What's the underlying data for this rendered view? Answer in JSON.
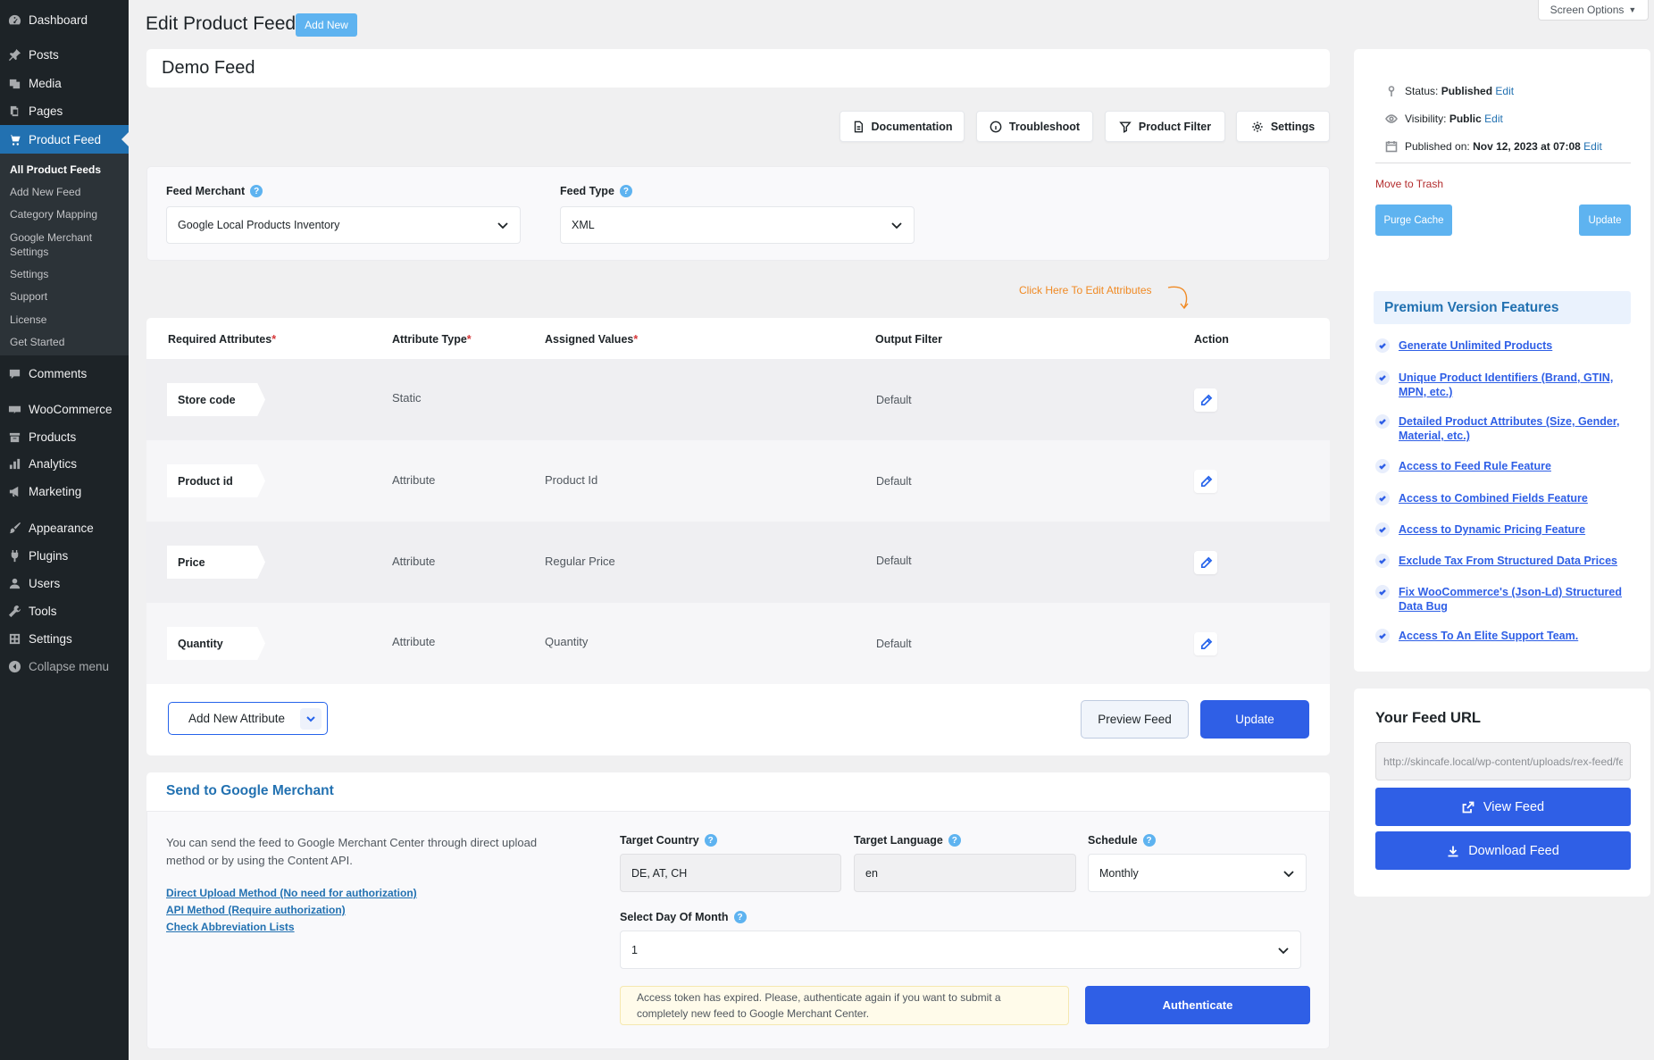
{
  "sidebar": {
    "menu": [
      {
        "label": "Dashboard",
        "icon": "dashboard-icon"
      },
      {
        "label": "Posts",
        "icon": "pin-icon"
      },
      {
        "label": "Media",
        "icon": "media-icon"
      },
      {
        "label": "Pages",
        "icon": "pages-icon"
      },
      {
        "label": "Product Feed",
        "icon": "cart-icon"
      },
      {
        "label": "Comments",
        "icon": "comment-icon"
      },
      {
        "label": "WooCommerce",
        "icon": "woo-icon"
      },
      {
        "label": "Products",
        "icon": "archive-icon"
      },
      {
        "label": "Analytics",
        "icon": "bar-chart-icon"
      },
      {
        "label": "Marketing",
        "icon": "megaphone-icon"
      },
      {
        "label": "Appearance",
        "icon": "brush-icon"
      },
      {
        "label": "Plugins",
        "icon": "plug-icon"
      },
      {
        "label": "Users",
        "icon": "user-icon"
      },
      {
        "label": "Tools",
        "icon": "wrench-icon"
      },
      {
        "label": "Settings",
        "icon": "settings-grid-icon"
      },
      {
        "label": "Collapse menu",
        "icon": "collapse-icon"
      }
    ],
    "submenu": [
      "All Product Feeds",
      "Add New Feed",
      "Category Mapping",
      "Google Merchant Settings",
      "Settings",
      "Support",
      "License",
      "Get Started"
    ]
  },
  "header": {
    "title": "Edit Product Feed",
    "add_new": "Add New",
    "screen_options": "Screen Options",
    "screen_options_arrow": "▼"
  },
  "feed": {
    "name": "Demo Feed"
  },
  "toolbar": {
    "documentation": "Documentation",
    "troubleshoot": "Troubleshoot",
    "product_filter": "Product Filter",
    "settings": "Settings"
  },
  "merchant": {
    "feed_merchant_label": "Feed Merchant",
    "feed_merchant_value": "Google Local Products Inventory",
    "feed_type_label": "Feed Type",
    "feed_type_value": "XML",
    "help_glyph": "?"
  },
  "attributes": {
    "edit_hint": "Click Here To Edit Attributes",
    "headers": {
      "required": "Required Attributes",
      "type": "Attribute Type",
      "values": "Assigned Values",
      "filter": "Output Filter",
      "action": "Action",
      "req_mark": "*"
    },
    "rows": [
      {
        "name": "Store code",
        "type": "Static",
        "value": "",
        "filter": "Default"
      },
      {
        "name": "Product id",
        "type": "Attribute",
        "value": "Product Id",
        "filter": "Default"
      },
      {
        "name": "Price",
        "type": "Attribute",
        "value": "Regular Price",
        "filter": "Default"
      },
      {
        "name": "Quantity",
        "type": "Attribute",
        "value": "Quantity",
        "filter": "Default"
      }
    ],
    "add_new": "Add New Attribute",
    "preview": "Preview Feed",
    "update": "Update"
  },
  "google_merchant": {
    "title": "Send to Google Merchant",
    "description": "You can send the feed to Google Merchant Center through direct upload method or by using the Content API.",
    "links": [
      "Direct Upload Method (No need for authorization)",
      "API Method (Require authorization)",
      "Check Abbreviation Lists"
    ],
    "target_country_label": "Target Country",
    "target_country_value": "DE, AT, CH",
    "target_language_label": "Target Language",
    "target_language_value": "en",
    "schedule_label": "Schedule",
    "schedule_value": "Monthly",
    "day_label": "Select Day Of Month",
    "day_value": "1",
    "token_note": "Access token has expired. Please, authenticate again if you want to submit a completely new feed to Google Merchant Center.",
    "authenticate": "Authenticate"
  },
  "publish": {
    "status_label": "Status:",
    "status_value": "Published",
    "visibility_label": "Visibility:",
    "visibility_value": "Public",
    "published_label": "Published on:",
    "published_value": "Nov 12, 2023 at 07:08",
    "edit": "Edit",
    "trash": "Move to Trash",
    "purge": "Purge Cache",
    "update": "Update"
  },
  "premium": {
    "title": "Premium Version Features",
    "features": [
      "Generate Unlimited Products",
      "Unique Product Identifiers (Brand, GTIN, MPN, etc.)",
      "Detailed Product Attributes (Size, Gender, Material, etc.)",
      "Access to Feed Rule Feature",
      "Access to Combined Fields Feature",
      "Access to Dynamic Pricing Feature",
      "Exclude Tax From Structured Data Prices",
      "Fix WooCommerce's (Json-Ld) Structured Data Bug",
      "Access To An Elite Support Team."
    ]
  },
  "feed_url": {
    "title": "Your Feed URL",
    "url": "http://skincafe.local/wp-content/uploads/rex-feed/feed-demo.xml",
    "view": "View Feed",
    "download": "Download Feed"
  },
  "colors": {
    "sidebar_bg": "#1d2327",
    "active_menu": "#2271b1",
    "primary_button": "#2f5fe6",
    "light_button": "#5eb3f0",
    "hint_orange": "#f08a24"
  }
}
